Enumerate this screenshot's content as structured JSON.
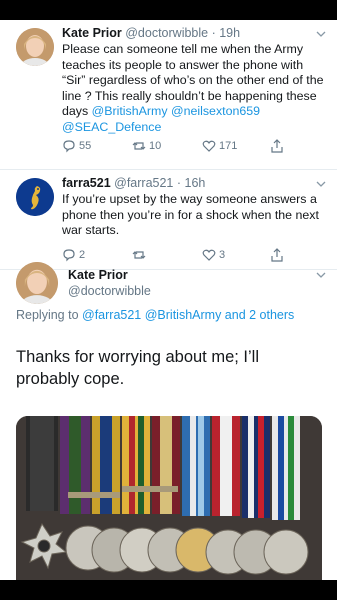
{
  "tweets": [
    {
      "name": "Kate Prior",
      "handle": "@doctorwibble",
      "time": "· 19h",
      "text_plain_1": "Please can someone tell me when the Army teaches its people to answer the phone with “Sir” regardless of who’s on the other end of the line ? This really shouldn’t be happening these days ",
      "mention_1": "@BritishArmy",
      "mention_2": "@neilsexton659",
      "mention_3": "@SEAC_Defence",
      "replies": "55",
      "retweets": "10",
      "likes": "171"
    },
    {
      "name": "farra521",
      "handle": "@farra521",
      "time": "· 16h",
      "text": "If you’re upset by the way someone answers a phone then you’re in for a shock when the next war starts.",
      "replies": "2",
      "retweets": "",
      "likes": "3"
    }
  ],
  "main_tweet": {
    "name": "Kate Prior",
    "handle": "@doctorwibble",
    "replying_prefix": "Replying to ",
    "replying_users": "@farra521 @BritishArmy and 2 others",
    "text": "Thanks for worrying about me; I’ll probably cope."
  },
  "icons": [
    "chevron-down-icon",
    "reply-icon",
    "retweet-icon",
    "like-icon",
    "share-icon"
  ],
  "colors": {
    "link": "#1b95e0",
    "secondary_text": "#657786",
    "divider": "#e6ecf0"
  }
}
